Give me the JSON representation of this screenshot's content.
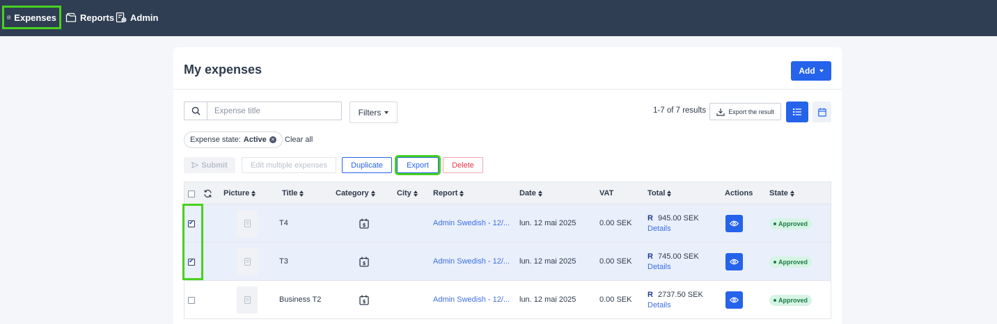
{
  "nav": {
    "items": [
      {
        "label": "Expenses",
        "icon": "receipt-icon",
        "active": true
      },
      {
        "label": "Reports",
        "icon": "folder-icon",
        "active": false
      },
      {
        "label": "Admin",
        "icon": "admin-settings-icon",
        "active": false
      }
    ]
  },
  "page": {
    "title": "My expenses",
    "add_label": "Add"
  },
  "toolbar": {
    "search_placeholder": "Expense title",
    "search_value": "",
    "filters_label": "Filters",
    "results_text": "1-7 of 7 results",
    "export_result_label": "Export the result"
  },
  "filter_chip": {
    "label": "Expense state:",
    "value": "Active",
    "clear_all": "Clear all"
  },
  "actions": {
    "submit": "Submit",
    "edit_multiple": "Edit multiple expenses",
    "duplicate": "Duplicate",
    "export": "Export",
    "delete": "Delete"
  },
  "table": {
    "headers": {
      "picture": "Picture",
      "title": "Title",
      "category": "Category",
      "city": "City",
      "report": "Report",
      "date": "Date",
      "vat": "VAT",
      "total": "Total",
      "actions": "Actions",
      "state": "State"
    },
    "rows": [
      {
        "checked": true,
        "title": "T4",
        "city": "",
        "report": "Admin Swedish - 12/...",
        "date": "lun. 12 mai 2025",
        "vat": "0.00 SEK",
        "total_prefix": "R",
        "total": "945.00 SEK",
        "details": "Details",
        "state": "Approved"
      },
      {
        "checked": true,
        "title": "T3",
        "city": "",
        "report": "Admin Swedish - 12/...",
        "date": "lun. 12 mai 2025",
        "vat": "0.00 SEK",
        "total_prefix": "R",
        "total": "745.00 SEK",
        "details": "Details",
        "state": "Approved"
      },
      {
        "checked": false,
        "title": "Business T2",
        "city": "",
        "report": "Admin Swedish - 12/...",
        "date": "lun. 12 mai 2025",
        "vat": "0.00 SEK",
        "total_prefix": "R",
        "total": "2737.50 SEK",
        "details": "Details",
        "state": "Approved"
      }
    ]
  },
  "colors": {
    "nav_bg": "#2f3e52",
    "primary": "#2563eb",
    "highlight": "#47d11f",
    "approved_bg": "#d6f4e4",
    "danger": "#e1394a"
  }
}
